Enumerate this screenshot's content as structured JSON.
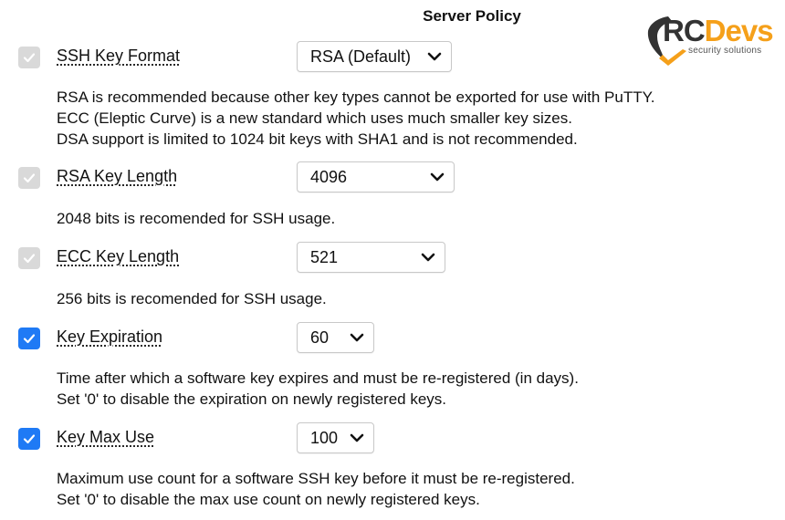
{
  "page": {
    "title": "Server Policy"
  },
  "logo": {
    "rc": "RC",
    "devs": "Devs",
    "tagline": "security solutions",
    "colors": {
      "dark": "#333333",
      "accent": "#f5a01a"
    }
  },
  "colors": {
    "checkbox_on": "#1f7af5",
    "checkbox_off": "#d9d9d9"
  },
  "settings": [
    {
      "label": "SSH Key Format",
      "checked": false,
      "value": "RSA (Default)",
      "description": [
        "RSA is recommended because other key types cannot be exported for use with PuTTY.",
        "ECC (Eleptic Curve) is a new standard which uses much smaller key sizes.",
        "DSA support is limited to 1024 bit keys with SHA1 and is not recommended."
      ]
    },
    {
      "label": "RSA Key Length",
      "checked": false,
      "value": "4096",
      "description": [
        "2048 bits is recomended for SSH usage."
      ]
    },
    {
      "label": "ECC Key Length",
      "checked": false,
      "value": "521",
      "description": [
        "256 bits is recomended for SSH usage."
      ]
    },
    {
      "label": "Key Expiration",
      "checked": true,
      "value": "60",
      "description": [
        "Time after which a software key expires and must be re-registered (in days).",
        "Set '0' to disable the expiration on newly registered keys."
      ]
    },
    {
      "label": "Key Max Use",
      "checked": true,
      "value": "100",
      "description": [
        "Maximum use count for a software SSH key before it must be re-registered.",
        "Set '0' to disable the max use count on newly registered keys."
      ]
    }
  ]
}
